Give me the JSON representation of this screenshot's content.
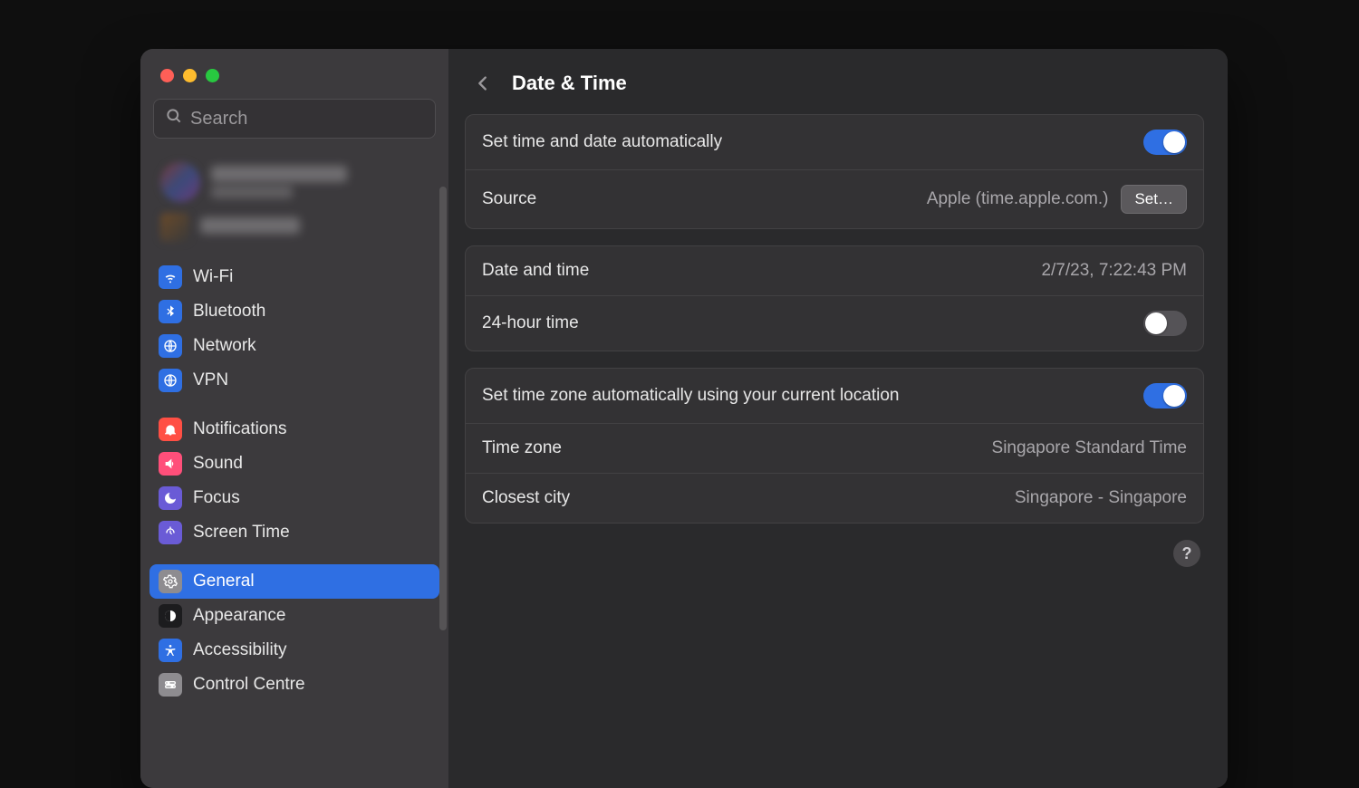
{
  "sidebar": {
    "search_placeholder": "Search",
    "groups": [
      {
        "items": [
          {
            "id": "wifi",
            "label": "Wi-Fi",
            "bg": "#2f6fe3"
          },
          {
            "id": "bluetooth",
            "label": "Bluetooth",
            "bg": "#2f6fe3"
          },
          {
            "id": "network",
            "label": "Network",
            "bg": "#2f6fe3"
          },
          {
            "id": "vpn",
            "label": "VPN",
            "bg": "#2f6fe3"
          }
        ]
      },
      {
        "items": [
          {
            "id": "notifications",
            "label": "Notifications",
            "bg": "#ff4f44"
          },
          {
            "id": "sound",
            "label": "Sound",
            "bg": "#ff4f7a"
          },
          {
            "id": "focus",
            "label": "Focus",
            "bg": "#6a5bd6"
          },
          {
            "id": "screentime",
            "label": "Screen Time",
            "bg": "#6a5bd6"
          }
        ]
      },
      {
        "items": [
          {
            "id": "general",
            "label": "General",
            "bg": "#8e8c90",
            "selected": true
          },
          {
            "id": "appearance",
            "label": "Appearance",
            "bg": "#1c1c1e"
          },
          {
            "id": "accessibility",
            "label": "Accessibility",
            "bg": "#2f6fe3"
          },
          {
            "id": "controlcentre",
            "label": "Control Centre",
            "bg": "#8e8c90"
          }
        ]
      }
    ]
  },
  "header": {
    "title": "Date & Time"
  },
  "panels": {
    "auto": {
      "set_auto_label": "Set time and date automatically",
      "set_auto_on": true,
      "source_label": "Source",
      "source_value": "Apple (time.apple.com.)",
      "source_button": "Set…"
    },
    "datetime": {
      "datetime_label": "Date and time",
      "datetime_value": "2/7/23, 7:22:43 PM",
      "h24_label": "24-hour time",
      "h24_on": false
    },
    "timezone": {
      "tz_auto_label": "Set time zone automatically using your current location",
      "tz_auto_on": true,
      "tz_label": "Time zone",
      "tz_value": "Singapore Standard Time",
      "city_label": "Closest city",
      "city_value": "Singapore - Singapore"
    }
  },
  "help_label": "?"
}
